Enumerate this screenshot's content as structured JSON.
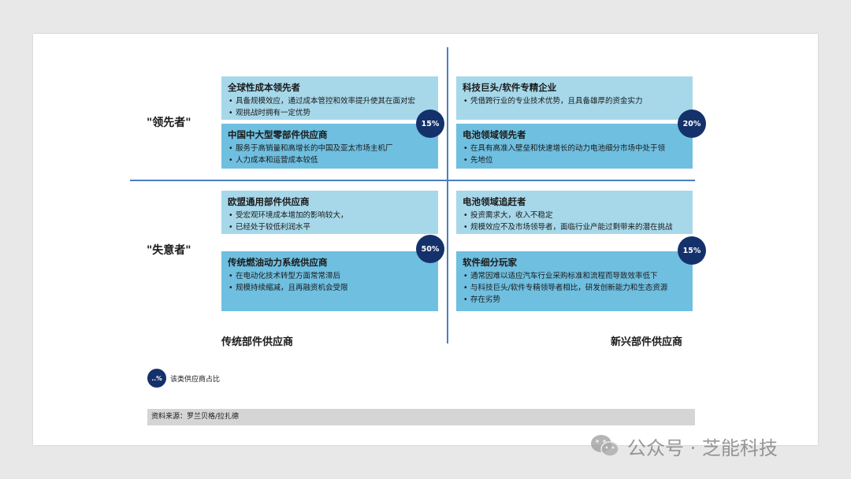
{
  "rows": {
    "leader": "\"领先者\"",
    "laggard": "\"失意者\""
  },
  "axes": {
    "left": "传统部件供应商",
    "right": "新兴部件供应商"
  },
  "quadrants": {
    "tl": {
      "badge": "15%",
      "top": {
        "title": "全球性成本领先者",
        "bullets": [
          "具备规模效应，通过成本管控和效率提升使其在面对宏",
          "观挑战时拥有一定优势"
        ]
      },
      "bottom": {
        "title": "中国中大型零部件供应商",
        "bullets": [
          "服务于高销量和高增长的中国及亚太市场主机厂",
          "人力成本和运营成本较低"
        ]
      }
    },
    "tr": {
      "badge": "20%",
      "top": {
        "title": "科技巨头/软件专精企业",
        "bullets": [
          "凭借跨行业的专业技术优势，且具备雄厚的资金实力"
        ]
      },
      "bottom": {
        "title": "电池领域领先者",
        "bullets": [
          "在具有高准入壁垒和快速增长的动力电池细分市场中处于领",
          "先地位"
        ]
      }
    },
    "bl": {
      "badge": "50%",
      "top": {
        "title": "欧盟通用部件供应商",
        "bullets": [
          "受宏观环境成本增加的影响较大，",
          "已经处于较低利润水平"
        ]
      },
      "bottom": {
        "title": "传统燃油动力系统供应商",
        "bullets": [
          "在电动化技术转型方面常常滞后",
          "规模持续缩减，且再融资机会受限"
        ]
      }
    },
    "br": {
      "badge": "15%",
      "top": {
        "title": "电池领域追赶者",
        "bullets": [
          "投资需求大，收入不稳定",
          "规模效应不及市场领导者，面临行业产能过剩带来的潜在挑战"
        ]
      },
      "bottom": {
        "title": "软件细分玩家",
        "bullets": [
          "通常因难以适应汽车行业采购标准和流程而导致效率低下",
          "与科技巨头/软件专精领导者相比，研发创新能力和生态资源",
          "存在劣势"
        ]
      }
    }
  },
  "legend": {
    "badge": "..%",
    "text": "该类供应商占比"
  },
  "source": "资料来源：罗兰贝格/拉扎德",
  "watermark": "公众号 · 芝能科技",
  "colors": {
    "light_box": "#a6d8ea",
    "mid_box": "#6fbfe0",
    "badge": "#15316b",
    "divider": "#4a7fc1"
  }
}
